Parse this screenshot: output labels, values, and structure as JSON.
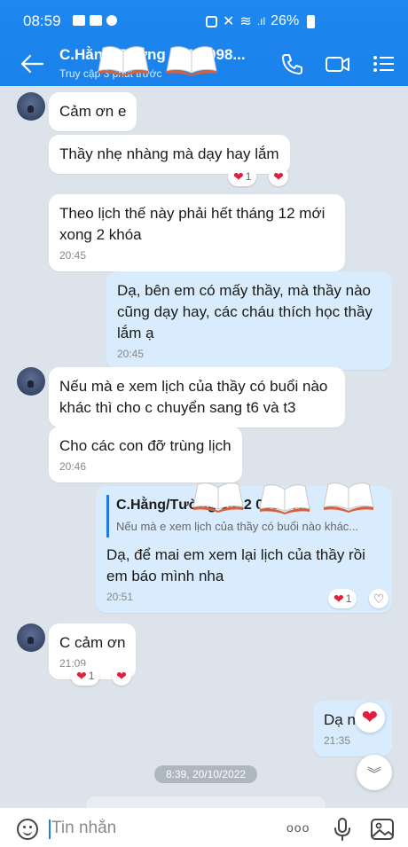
{
  "status_bar": {
    "time": "08:59",
    "battery": "26%"
  },
  "header": {
    "title": "C.Hằng/Tường 0912 098...",
    "subtitle": "Truy cập 3 phút trước"
  },
  "messages": [
    {
      "text": "Cảm ơn e"
    },
    {
      "text": "Thầy nhẹ nhàng mà dạy hay lắm",
      "reaction_count": "1"
    },
    {
      "line1": "Theo lịch thế này phải hết tháng 12 mới",
      "line2": "xong 2 khóa",
      "time": "20:45"
    },
    {
      "line1": "Dạ, bên em có mấy thầy, mà thầy nào",
      "line2": "cũng dạy hay, các cháu thích học thầy",
      "line3": "lắm ạ",
      "time": "20:45"
    },
    {
      "line1": "Nếu mà e xem lịch của thầy có buổi nào",
      "line2": "khác thì cho c chuyển sang t6 và t3"
    },
    {
      "text": "Cho các con đỡ trùng lịch",
      "time": "20:46"
    },
    {
      "quote_name": "C.Hằng/Tường 0912 098 47...",
      "quote_text": "Nếu mà e xem lịch của thầy có buổi nào khác...",
      "line1": "Dạ, để mai em xem lại lịch của thầy rồi",
      "line2": "em báo mình nha",
      "time": "20:51",
      "reaction_count": "1"
    },
    {
      "text": "C cảm ơn",
      "time": "21:09",
      "reaction_count": "1"
    },
    {
      "text": "Dạ nh",
      "time": "21:35"
    }
  ],
  "date_separator": "8:39, 20/10/2022",
  "input": {
    "placeholder": "Tin nhắn",
    "more": "ooo"
  },
  "colors": {
    "header": "#1a82ea",
    "chat_bg": "#dde3ea",
    "my_bubble": "#d8ecfd",
    "heart": "#e01f3d"
  }
}
